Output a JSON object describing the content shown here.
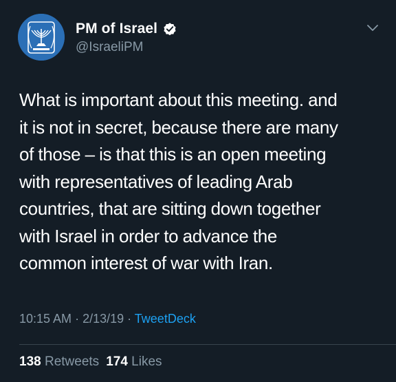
{
  "account": {
    "display_name": "PM of Israel",
    "handle": "@IsraeliPM",
    "avatar_icon": "menorah-emblem-icon",
    "verified_icon": "verified-badge-icon"
  },
  "menu_icon": "chevron-down-icon",
  "tweet": {
    "lines": [
      "What is important about this meeting. and",
      "it is not in secret, because there are many",
      "of those – is that this is an open meeting",
      "with representatives of leading Arab",
      "countries, that are sitting down together",
      "with Israel in order to advance the",
      "common interest of war with Iran."
    ],
    "time": "10:15 AM",
    "separator": " · ",
    "date": "2/13/19",
    "source": "TweetDeck"
  },
  "stats": {
    "retweets_count": "138",
    "retweets_label": "Retweets",
    "likes_count": "174",
    "likes_label": "Likes"
  },
  "colors": {
    "background": "#141d26",
    "secondary_text": "#8899a6",
    "link": "#1da1f2",
    "avatar": "#2b6fb6"
  }
}
